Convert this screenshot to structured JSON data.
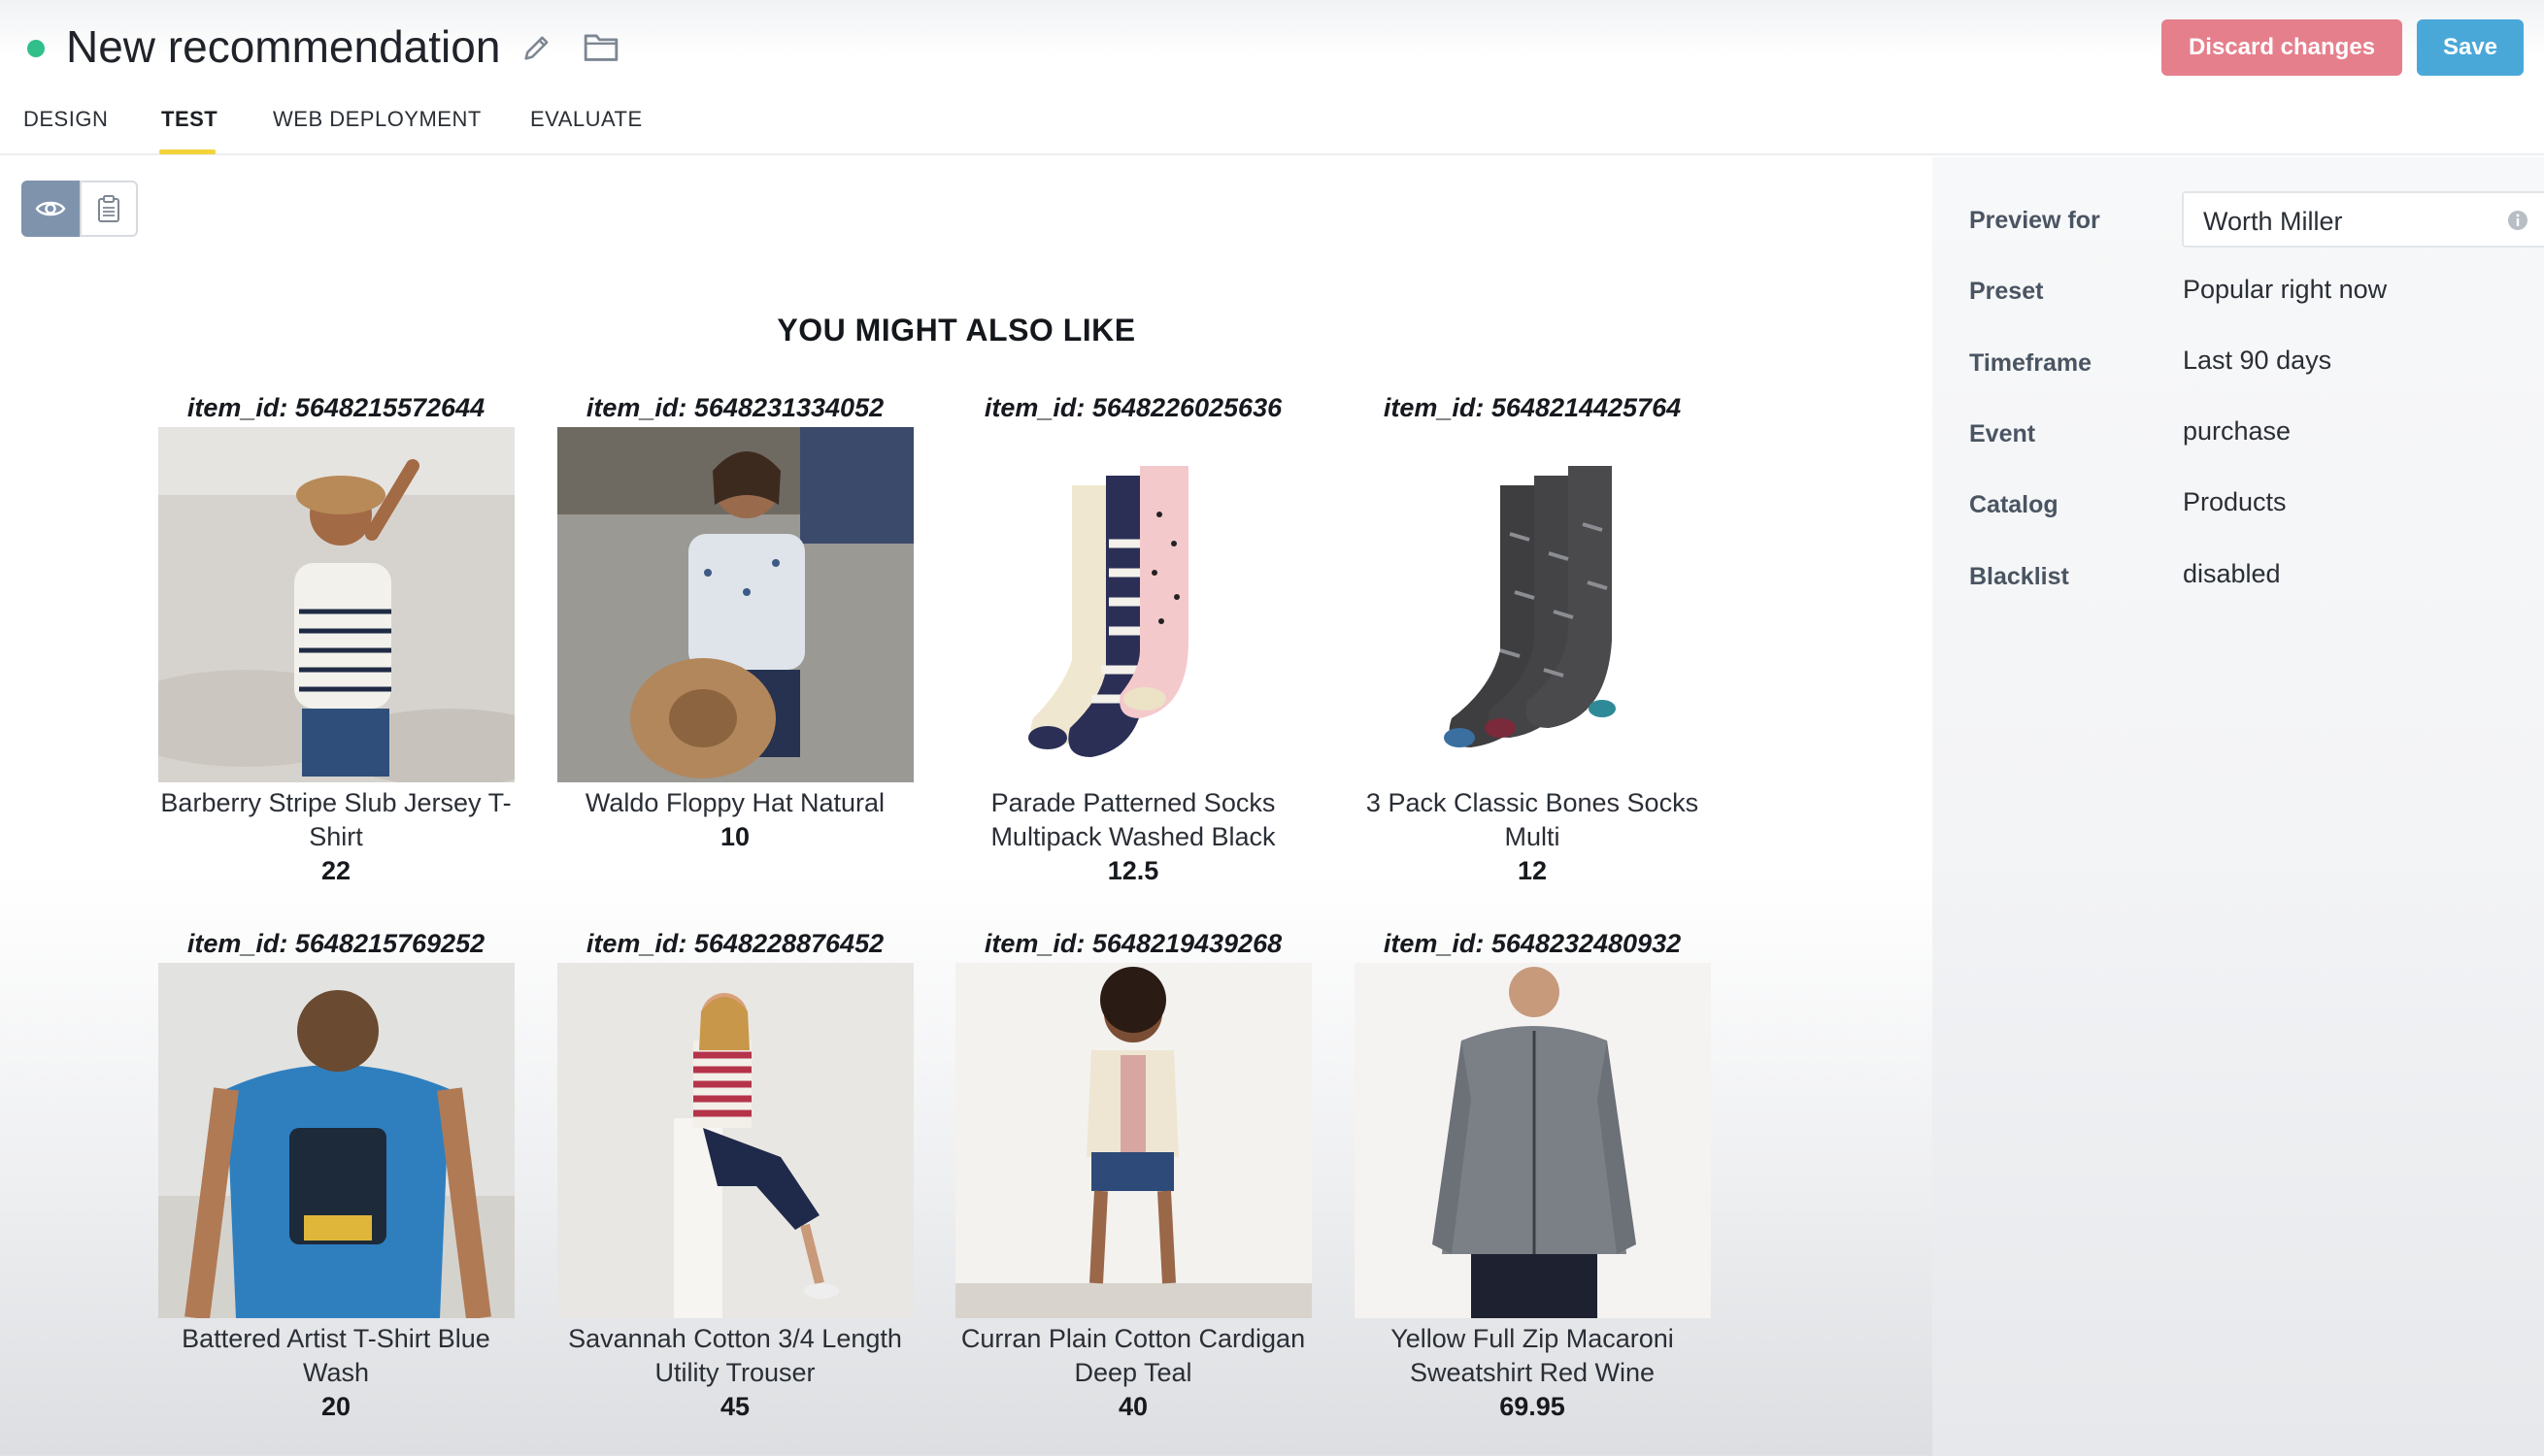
{
  "header": {
    "title": "New recommendation",
    "status_color": "#2fbf8a",
    "icons": [
      "pencil-icon",
      "folder-icon"
    ],
    "discard_label": "Discard changes",
    "save_label": "Save",
    "discard_color": "#e57f8c",
    "save_color": "#4aa8d8"
  },
  "tabs": [
    {
      "label": "DESIGN",
      "active": false
    },
    {
      "label": "TEST",
      "active": true
    },
    {
      "label": "WEB DEPLOYMENT",
      "active": false
    },
    {
      "label": "EVALUATE",
      "active": false
    }
  ],
  "view_toggle": {
    "selected": "eye-icon",
    "options": [
      "eye-icon",
      "clipboard-icon"
    ]
  },
  "preview": {
    "title": "YOU MIGHT ALSO LIKE",
    "items": [
      {
        "id": "item_id: 5648215572644",
        "name": "Barberry Stripe Slub Jersey T-Shirt",
        "price": "22"
      },
      {
        "id": "item_id: 5648231334052",
        "name": "Waldo Floppy Hat Natural",
        "price": "10"
      },
      {
        "id": "item_id: 5648226025636",
        "name": "Parade Patterned Socks Multipack Washed Black",
        "price": "12.5"
      },
      {
        "id": "item_id: 5648214425764",
        "name": "3 Pack Classic Bones Socks Multi",
        "price": "12"
      },
      {
        "id": "item_id: 5648215769252",
        "name": "Battered Artist T-Shirt Blue Wash",
        "price": "20"
      },
      {
        "id": "item_id: 5648228876452",
        "name": "Savannah Cotton 3/4 Length Utility Trouser",
        "price": "45"
      },
      {
        "id": "item_id: 5648219439268",
        "name": "Curran Plain Cotton Cardigan Deep Teal",
        "price": "40"
      },
      {
        "id": "item_id: 5648232480932",
        "name": "Yellow Full Zip Macaroni Sweatshirt Red Wine",
        "price": "69.95"
      }
    ]
  },
  "settings": {
    "preview_for_label": "Preview for",
    "preview_for_value": "Worth Miller",
    "preset_label": "Preset",
    "preset_value": "Popular right now",
    "timeframe_label": "Timeframe",
    "timeframe_value": "Last 90 days",
    "event_label": "Event",
    "event_value": "purchase",
    "catalog_label": "Catalog",
    "catalog_value": "Products",
    "blacklist_label": "Blacklist",
    "blacklist_value": "disabled"
  }
}
